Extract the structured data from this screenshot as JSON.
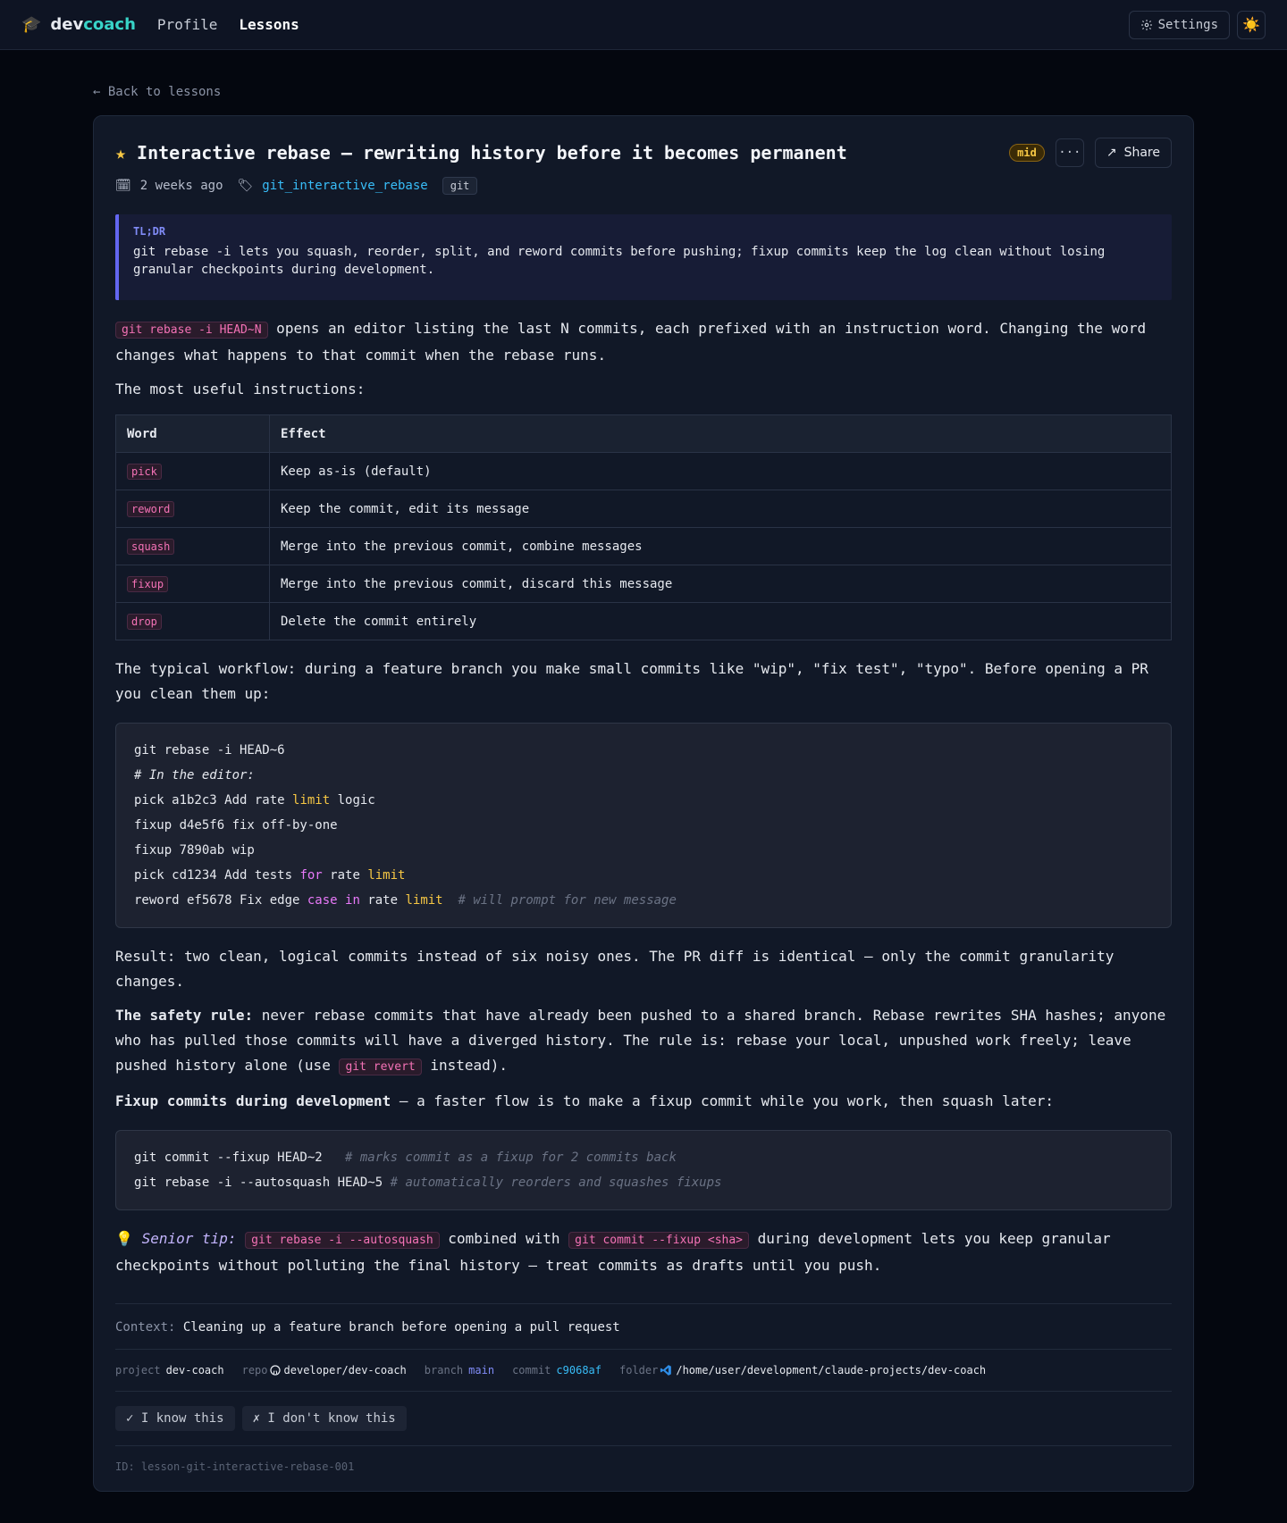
{
  "app": {
    "brand_part1": "dev",
    "brand_part2": "coach",
    "brand_icon": "graduation-cap-icon",
    "nav": [
      {
        "label": "Profile",
        "active": false
      },
      {
        "label": "Lessons",
        "active": true
      }
    ],
    "settings_label": "Settings",
    "theme_icon": "sun-icon"
  },
  "back_link": "← Back to lessons",
  "lesson": {
    "title": "Interactive rebase — rewriting history before it becomes permanent",
    "level_badge": "mid",
    "share_label": "Share",
    "more_label": "···",
    "date": "2 weeks ago",
    "tag_link": "git_interactive_rebase",
    "chip": "git",
    "tldr_label": "TL;DR",
    "tldr_text": "git rebase -i lets you squash, reorder, split, and reword commits before pushing; fixup commits keep the log clean without losing granular checkpoints during development.",
    "intro_code": "git rebase -i HEAD~N",
    "intro_text": " opens an editor listing the last N commits, each prefixed with an instruction word. Changing the word changes what happens to that commit when the rebase runs.",
    "useful_heading": "The most useful instructions:",
    "table": {
      "headers": [
        "Word",
        "Effect"
      ],
      "rows": [
        {
          "word": "pick",
          "effect": "Keep as-is (default)"
        },
        {
          "word": "reword",
          "effect": "Keep the commit, edit its message"
        },
        {
          "word": "squash",
          "effect": "Merge into the previous commit, combine messages"
        },
        {
          "word": "fixup",
          "effect": "Merge into the previous commit, discard this message"
        },
        {
          "word": "drop",
          "effect": "Delete the commit entirely"
        }
      ]
    },
    "workflow_text": "The typical workflow: during a feature branch you make small commits like \"wip\", \"fix test\", \"typo\". Before opening a PR you clean them up:",
    "code1": {
      "l1": "git rebase -i HEAD~6",
      "l2": "# In the editor:",
      "l3a": "pick a1b2c3 Add rate ",
      "l3b": "limit",
      "l3c": " logic",
      "l4": "fixup d4e5f6 fix off-by-one",
      "l5": "fixup 7890ab wip",
      "l6a": "pick cd1234 Add tests ",
      "l6b": "for",
      "l6c": " rate ",
      "l6d": "limit",
      "l7a": "reword ef5678 Fix edge ",
      "l7b": "case",
      "l7c": " ",
      "l7d": "in",
      "l7e": " rate ",
      "l7f": "limit",
      "l7g": "  # will prompt for new message"
    },
    "result_text": "Result: two clean, logical commits instead of six noisy ones. The PR diff is identical — only the commit granularity changes.",
    "safety_bold": "The safety rule:",
    "safety_text": " never rebase commits that have already been pushed to a shared branch. Rebase rewrites SHA hashes; anyone who has pulled those commits will have a diverged history. The rule is: rebase your local, unpushed work freely; leave pushed history alone (use ",
    "safety_code": "git revert",
    "safety_tail": " instead).",
    "fixup_bold": "Fixup commits during development",
    "fixup_text": " — a faster flow is to make a fixup commit while you work, then squash later:",
    "code2": {
      "l1a": "git commit --fixup HEAD~2",
      "l1b": "   # marks commit as a fixup for 2 commits back",
      "l2a": "git rebase -i --autosquash HEAD~5",
      "l2b": " # automatically reorders and squashes fixups"
    },
    "tip_icon": "💡",
    "tip_label": "Senior tip:",
    "tip_code1": "git rebase -i --autosquash",
    "tip_mid": " combined with ",
    "tip_code2": "git commit --fixup <sha>",
    "tip_text": " during development lets you keep granular checkpoints without polluting the final history — treat commits as drafts until you push.",
    "context_key": "Context:",
    "context_value": "Cleaning up a feature branch before opening a pull request",
    "info": {
      "project_k": "project",
      "project_v": "dev-coach",
      "repo_k": "repo",
      "repo_v": "developer/dev-coach",
      "branch_k": "branch",
      "branch_v": "main",
      "commit_k": "commit",
      "commit_v": "c9068af",
      "folder_k": "folder",
      "folder_v": "/home/user/development/claude-projects/dev-coach"
    },
    "know_label": "✓ I know this",
    "dont_know_label": "✗ I don't know this",
    "id_text": "ID: lesson-git-interactive-rebase-001"
  },
  "colors": {
    "accent": "#38d4c8",
    "link": "#38bdf8",
    "code_pink": "#f472b6",
    "badge_yellow": "#f6c744",
    "tldr_border": "#6366f1"
  }
}
